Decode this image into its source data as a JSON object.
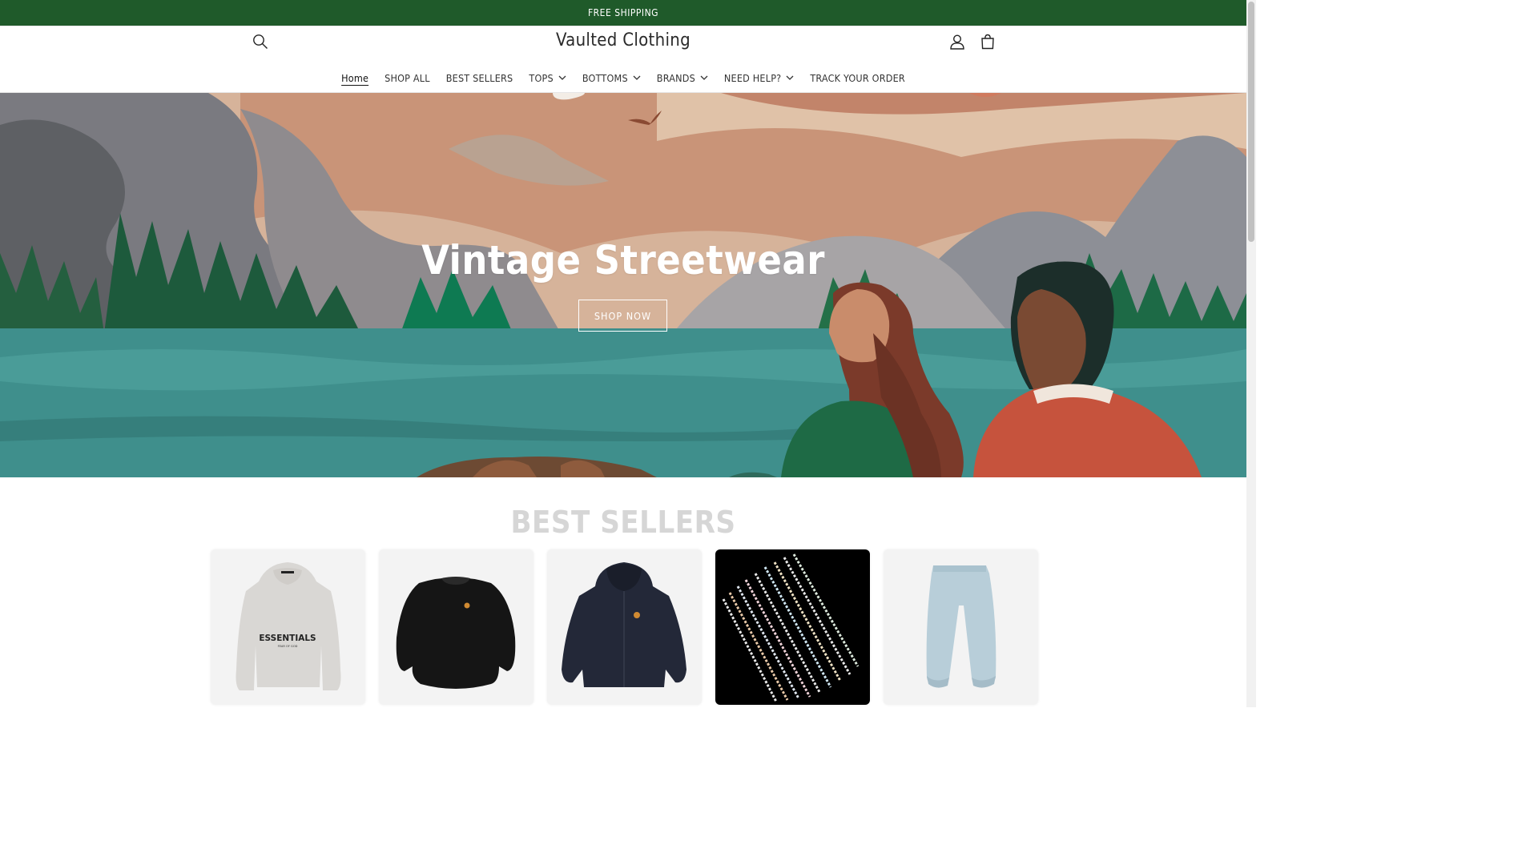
{
  "announcement": {
    "text": "FREE SHIPPING"
  },
  "header": {
    "logo": "Vaulted Clothing",
    "icons": {
      "search": "search-icon",
      "account": "account-icon",
      "cart": "cart-icon"
    }
  },
  "nav": {
    "items": [
      {
        "label": "Home",
        "active": true,
        "dropdown": false
      },
      {
        "label": "SHOP ALL",
        "dropdown": false
      },
      {
        "label": "BEST SELLERS",
        "dropdown": false
      },
      {
        "label": "TOPS",
        "dropdown": true
      },
      {
        "label": "BOTTOMS",
        "dropdown": true
      },
      {
        "label": "BRANDS",
        "dropdown": true
      },
      {
        "label": "NEED HELP?",
        "dropdown": true
      },
      {
        "label": "TRACK YOUR ORDER",
        "dropdown": false
      }
    ]
  },
  "hero": {
    "title": "Vintage Streetwear",
    "button_label": "SHOP NOW"
  },
  "best_sellers": {
    "title": "BEST SELLERS",
    "products": [
      {
        "image": "grey essentials hoodie",
        "print": "ESSENTIALS",
        "subprint": "FEAR OF GOD"
      },
      {
        "image": "black crewneck sweatshirt"
      },
      {
        "image": "navy zip-up hoodie"
      },
      {
        "image": "tennis chain bracelets"
      },
      {
        "image": "light blue sweatpants"
      }
    ]
  },
  "colors": {
    "announcement_bg": "#1f5a2a",
    "text": "#121212",
    "section_title": "#d6d6d6"
  }
}
